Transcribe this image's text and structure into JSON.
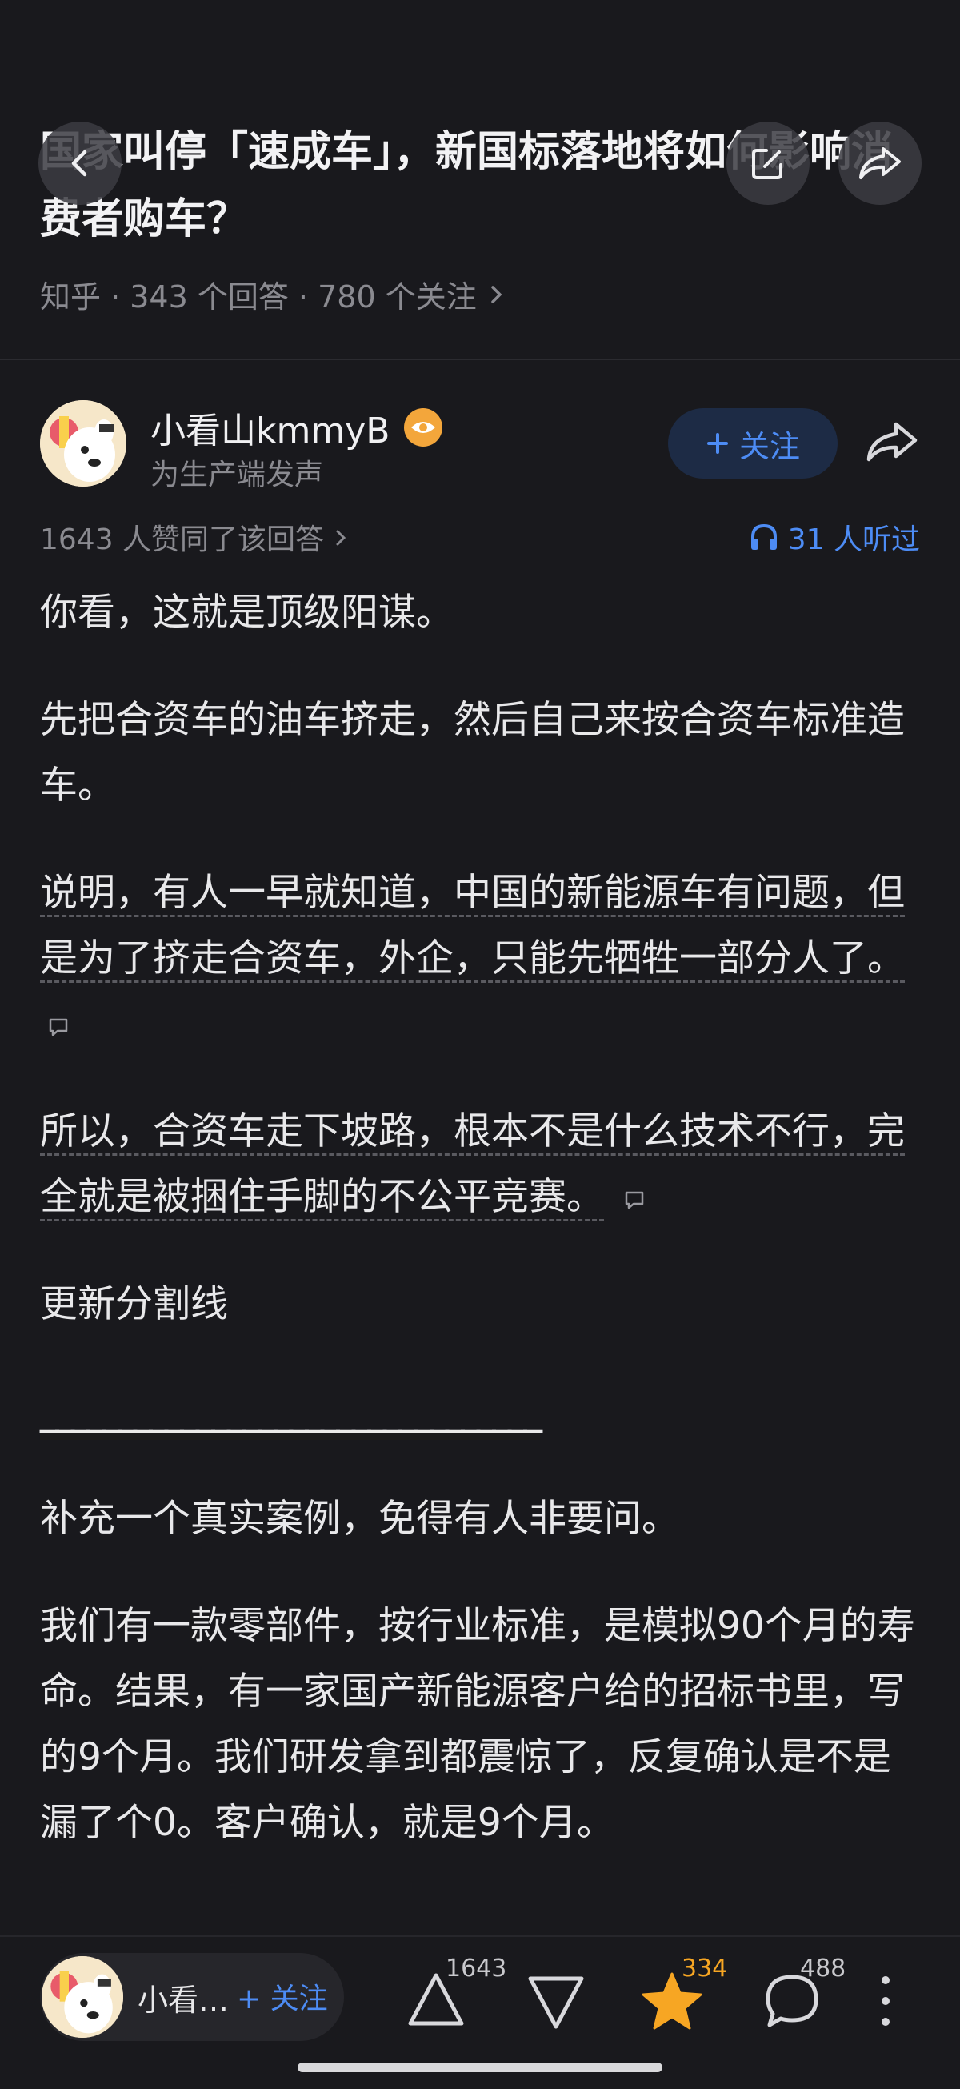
{
  "question": {
    "title": "国家叫停「速成车」，新国标落地将如何影响消费者购车？",
    "meta": "知乎 · 343 个回答 · 780 个关注"
  },
  "author": {
    "name": "小看山kmmyB",
    "tagline": "为生产端发声",
    "follow_label": "关注"
  },
  "stats": {
    "likes": "1643 人赞同了该回答",
    "listened": "31 人听过"
  },
  "answer": {
    "p1": "你看，这就是顶级阳谋。",
    "p2": "先把合资车的油车挤走，然后自己来按合资车标准造车。",
    "p3": "说明，有人一早就知道，中国的新能源车有问题，但是为了挤走合资车，外企，只能先牺牲一部分人了。",
    "p4": "所以，合资车走下坡路，根本不是什么技术不行，完全就是被捆住手脚的不公平竞赛。",
    "p5": "更新分割线",
    "p6": "________________________________",
    "p7": "补充一个真实案例，免得有人非要问。",
    "p8": "我们有一款零部件，按行业标准，是模拟90个月的寿命。结果，有一家国产新能源客户给的招标书里，写的9个月。我们研发拿到都震惊了，反复确认是不是漏了个0。客户确认，就是9个月。"
  },
  "bottom_bar": {
    "author_short": "小看…",
    "follow_label": "+ 关注",
    "upvote_count": "1643",
    "favorite_count": "334",
    "comment_count": "488"
  },
  "colors": {
    "background": "#19191d",
    "accent_blue": "#4d8cf5",
    "favorite_orange": "#f7a623"
  }
}
